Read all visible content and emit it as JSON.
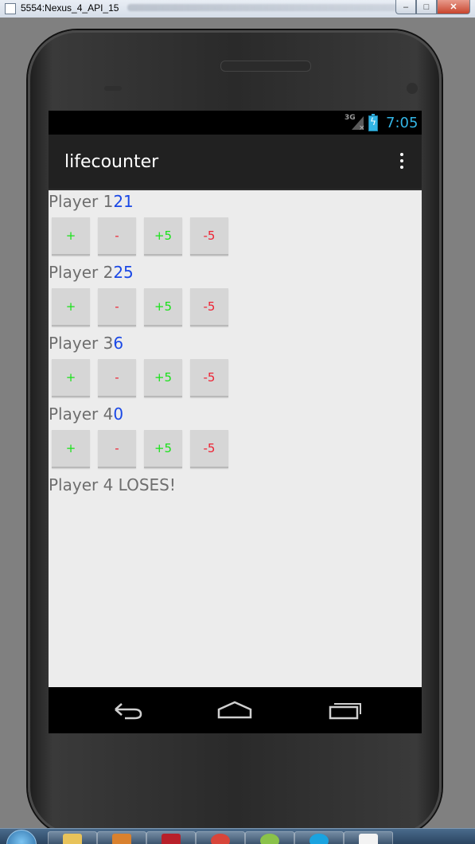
{
  "window": {
    "title": "5554:Nexus_4_API_15",
    "minimize_glyph": "–",
    "maximize_glyph": "□",
    "close_glyph": "✕"
  },
  "statusbar": {
    "network": "3G",
    "time": "7:05"
  },
  "actionbar": {
    "app_name": "lifecounter",
    "menu_icon": "overflow-menu-icon"
  },
  "players": [
    {
      "label": "Player 1",
      "life": "21",
      "buttons": [
        "+",
        "-",
        "+5",
        "-5"
      ]
    },
    {
      "label": "Player 2",
      "life": "25",
      "buttons": [
        "+",
        "-",
        "+5",
        "-5"
      ]
    },
    {
      "label": "Player 3",
      "life": "6",
      "buttons": [
        "+",
        "-",
        "+5",
        "-5"
      ]
    },
    {
      "label": "Player 4",
      "life": "0",
      "buttons": [
        "+",
        "-",
        "+5",
        "-5"
      ]
    }
  ],
  "status_message": "Player 4 LOSES!",
  "navbar": {
    "back": "back-icon",
    "home": "home-icon",
    "recents": "recents-icon"
  },
  "colors": {
    "life_value": "#1a48e6",
    "plus_buttons": "#19e219",
    "minus_buttons": "#ee2233",
    "clock": "#33b5e5"
  }
}
